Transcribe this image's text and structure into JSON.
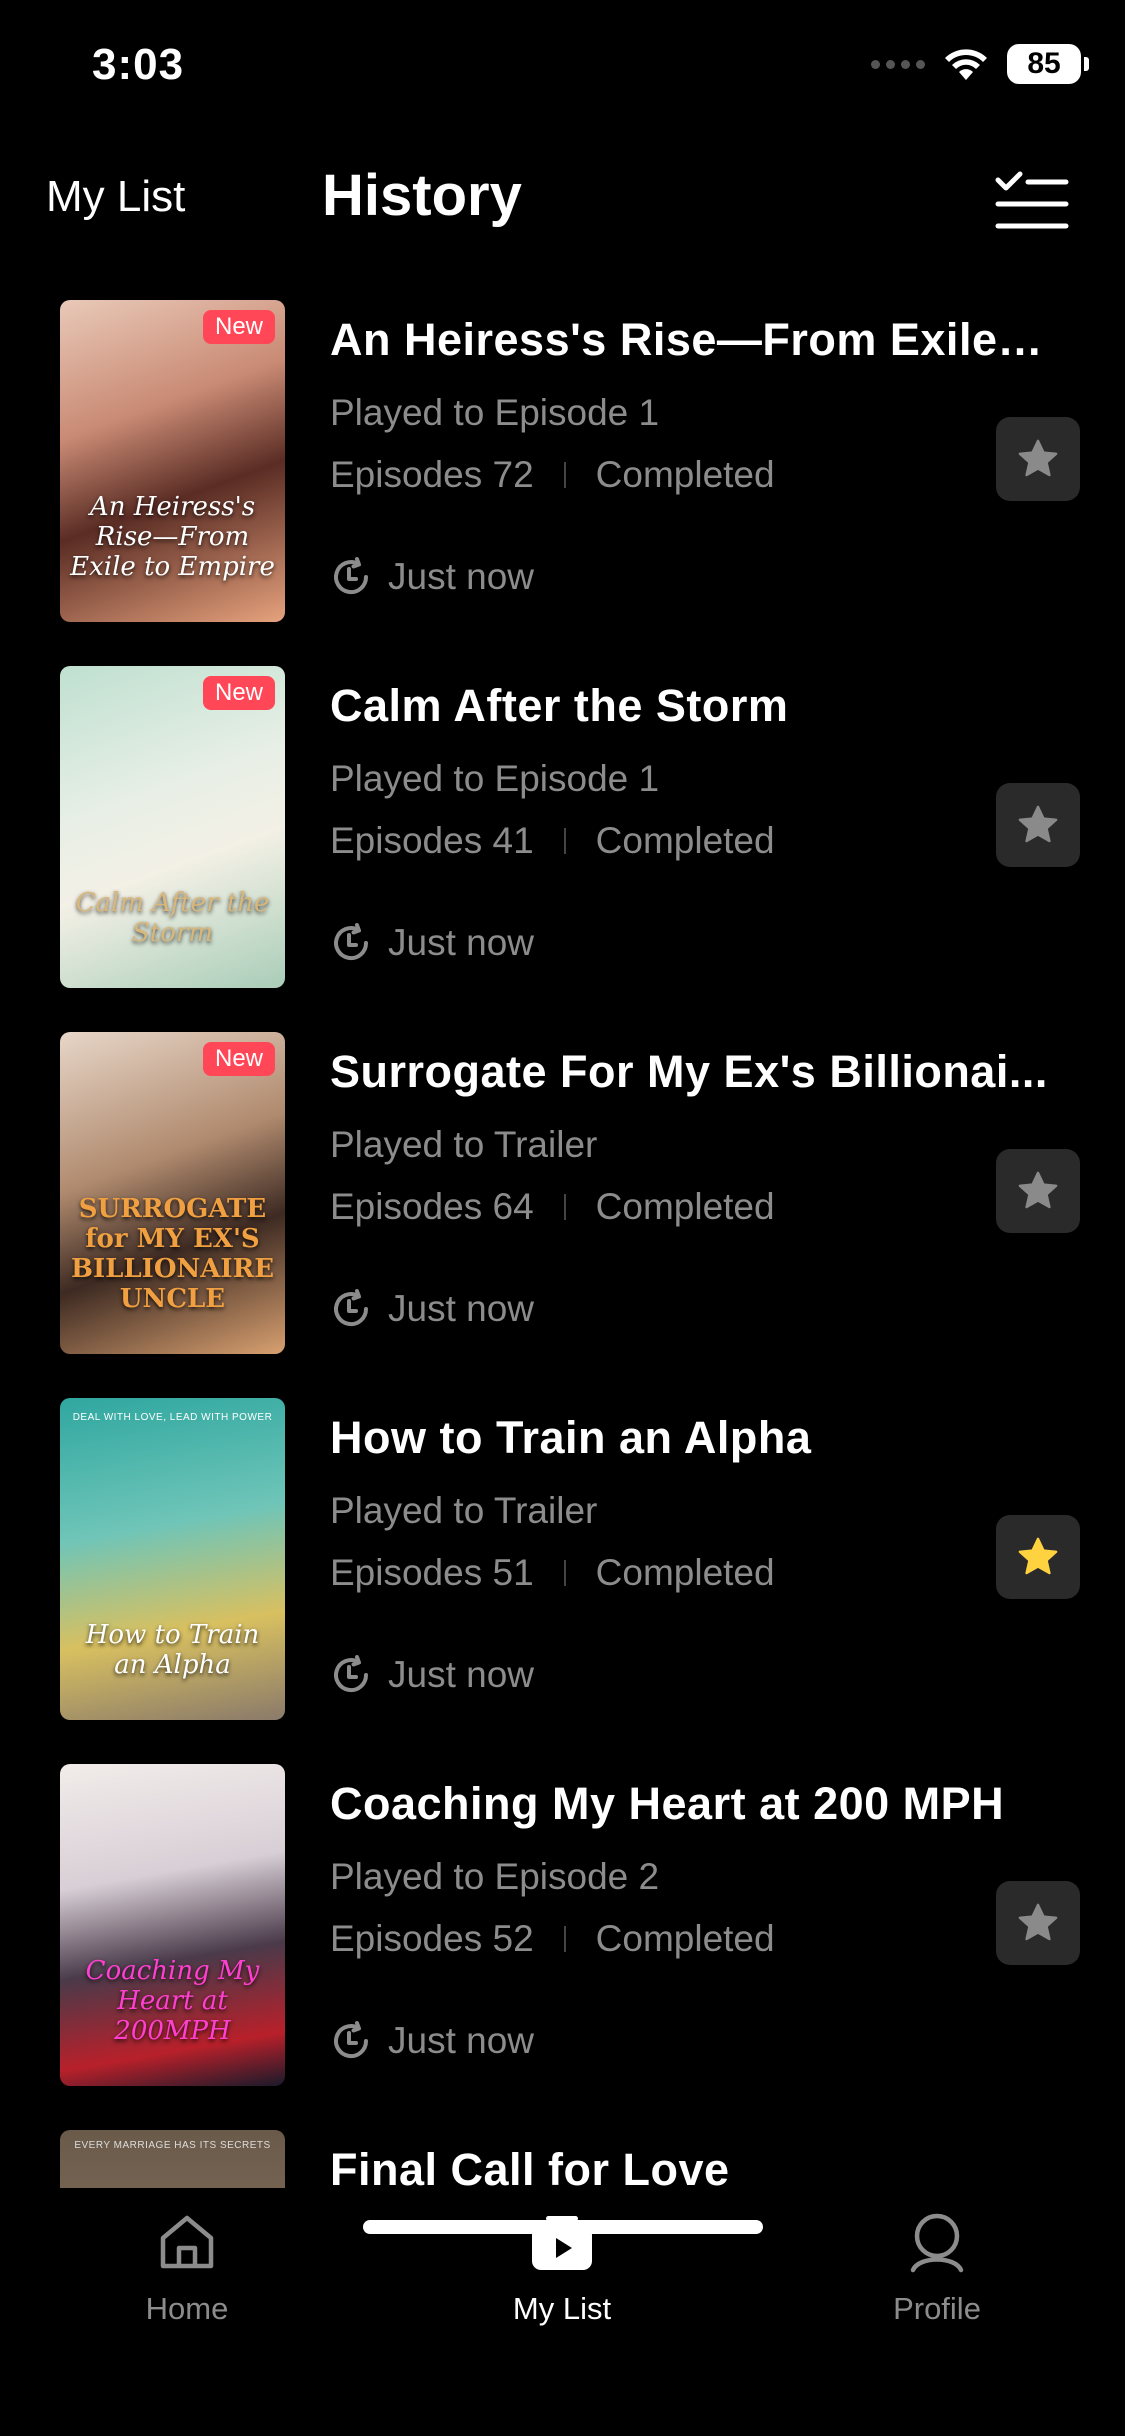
{
  "status_bar": {
    "time": "3:03",
    "battery": "85"
  },
  "header": {
    "tab_my_list": "My List",
    "tab_history": "History"
  },
  "items": [
    {
      "title": "An Heiress's Rise—From Exile t...",
      "poster_title": "An Heiress's Rise—From Exile to Empire",
      "badge": "New",
      "played": "Played to Episode 1",
      "episodes": "Episodes 72",
      "status": "Completed",
      "time": "Just now",
      "favorited": false
    },
    {
      "title": "Calm After the Storm",
      "poster_title": "Calm After the Storm",
      "badge": "New",
      "played": "Played to Episode 1",
      "episodes": "Episodes 41",
      "status": "Completed",
      "time": "Just now",
      "favorited": false
    },
    {
      "title": "Surrogate For My Ex's Billionai...",
      "poster_title": "SURROGATE for MY EX'S BILLIONAIRE UNCLE",
      "badge": "New",
      "played": "Played to Trailer",
      "episodes": "Episodes 64",
      "status": "Completed",
      "time": "Just now",
      "favorited": false
    },
    {
      "title": "How to Train an Alpha",
      "poster_title": "How to Train an Alpha",
      "poster_tagline": "DEAL WITH LOVE, LEAD WITH POWER",
      "badge": "",
      "played": "Played to Trailer",
      "episodes": "Episodes 51",
      "status": "Completed",
      "time": "Just now",
      "favorited": true
    },
    {
      "title": "Coaching My Heart at 200 MPH",
      "poster_title": "Coaching My Heart at 200MPH",
      "badge": "",
      "played": "Played to Episode 2",
      "episodes": "Episodes 52",
      "status": "Completed",
      "time": "Just now",
      "favorited": false
    },
    {
      "title": "Final Call for Love",
      "poster_title": "",
      "poster_tagline": "EVERY MARRIAGE HAS ITS SECRETS",
      "badge": "",
      "played": "",
      "episodes": "",
      "status": "",
      "time": "",
      "favorited": false
    }
  ],
  "nav": {
    "home": "Home",
    "my_list": "My List",
    "profile": "Profile"
  },
  "colors": {
    "background": "#000000",
    "muted_text": "#8c8c8c",
    "badge_new": "#ff4757",
    "star_active": "#ffd23f",
    "star_inactive": "#8a8a8a",
    "fav_bg": "#2a2a2a"
  }
}
